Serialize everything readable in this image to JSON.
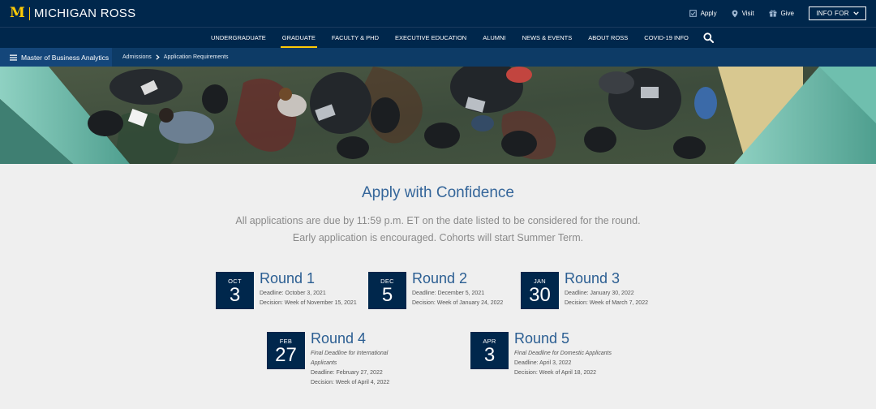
{
  "brand": {
    "mark": "M",
    "name": "MICHIGAN ROSS"
  },
  "utility": {
    "apply": "Apply",
    "visit": "Visit",
    "give": "Give",
    "info_for": "INFO FOR"
  },
  "nav": {
    "items": [
      "UNDERGRADUATE",
      "GRADUATE",
      "FACULTY & PHD",
      "EXECUTIVE EDUCATION",
      "ALUMNI",
      "NEWS & EVENTS",
      "ABOUT ROSS",
      "COVID-19 INFO"
    ],
    "active_index": 1
  },
  "subnav": {
    "program": "Master of Business Analytics",
    "breadcrumb": [
      "Admissions",
      "Application Requirements"
    ]
  },
  "main": {
    "title": "Apply with Confidence",
    "intro_line1": "All applications are due by 11:59 p.m. ET on the date listed to be considered for the round.",
    "intro_line2": "Early application is encouraged. Cohorts will start Summer Term."
  },
  "rounds": [
    {
      "month": "OCT",
      "day": "3",
      "name": "Round 1",
      "note": "",
      "deadline": "Deadline: October 3, 2021",
      "decision": "Decision: Week of November 15, 2021"
    },
    {
      "month": "DEC",
      "day": "5",
      "name": "Round 2",
      "note": "",
      "deadline": "Deadline: December 5, 2021",
      "decision": "Decision: Week of January 24, 2022"
    },
    {
      "month": "JAN",
      "day": "30",
      "name": "Round 3",
      "note": "",
      "deadline": "Deadline: January 30, 2022",
      "decision": "Decision: Week of March 7, 2022"
    },
    {
      "month": "FEB",
      "day": "27",
      "name": "Round 4",
      "note": "Final Deadline for International Applicants",
      "deadline": "Deadline: February 27, 2022",
      "decision": "Decision: Week of April 4, 2022"
    },
    {
      "month": "APR",
      "day": "3",
      "name": "Round 5",
      "note": "Final Deadline for Domestic Applicants",
      "deadline": "Deadline: April 3, 2022",
      "decision": "Decision: Week of April 18, 2022"
    }
  ],
  "colors": {
    "navy": "#00274c",
    "maize": "#ffcb05",
    "accent_blue": "#35669a",
    "background": "#efefef"
  },
  "icons": {
    "menu": "hamburger-icon",
    "search": "search-icon",
    "apply": "checkbox-icon",
    "visit": "map-pin-icon",
    "give": "gift-icon",
    "info_for": "chevron-down-icon",
    "breadcrumb_separator": "chevron-right-icon"
  }
}
